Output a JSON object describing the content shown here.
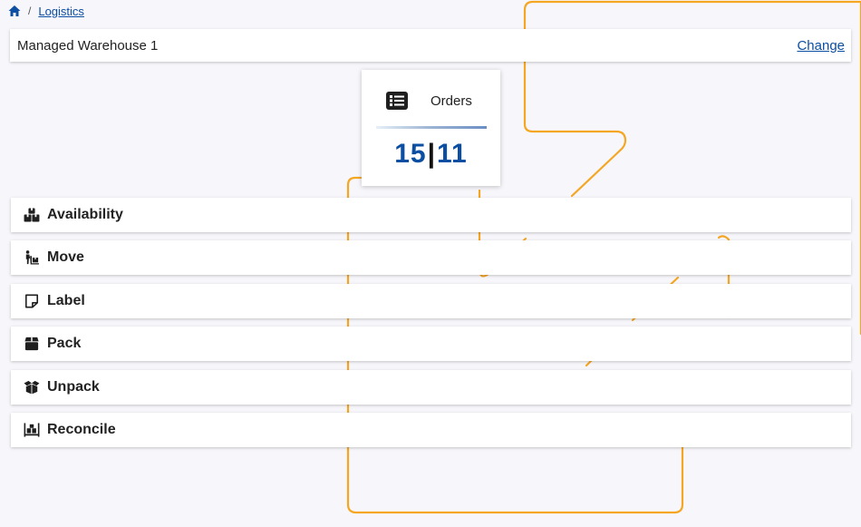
{
  "breadcrumb": {
    "home_icon": "home-icon",
    "separator": "/",
    "current": "Logistics"
  },
  "location": {
    "name": "Managed Warehouse 1",
    "change_label": "Change"
  },
  "orders": {
    "icon": "list-icon",
    "label": "Orders",
    "count_left": "15",
    "count_sep": "|",
    "count_right": "11"
  },
  "menu": {
    "items": [
      {
        "label": "Availability",
        "icon": "boxes-icon"
      },
      {
        "label": "Move",
        "icon": "dolly-icon"
      },
      {
        "label": "Label",
        "icon": "sticky-note-icon"
      },
      {
        "label": "Pack",
        "icon": "box-icon"
      },
      {
        "label": "Unpack",
        "icon": "open-box-icon"
      },
      {
        "label": "Reconcile",
        "icon": "pallet-icon"
      }
    ]
  },
  "colors": {
    "link": "#0b4ea2",
    "count": "#0b4ea2",
    "accent_line": "#f5a623",
    "background": "#f7f7fb"
  }
}
